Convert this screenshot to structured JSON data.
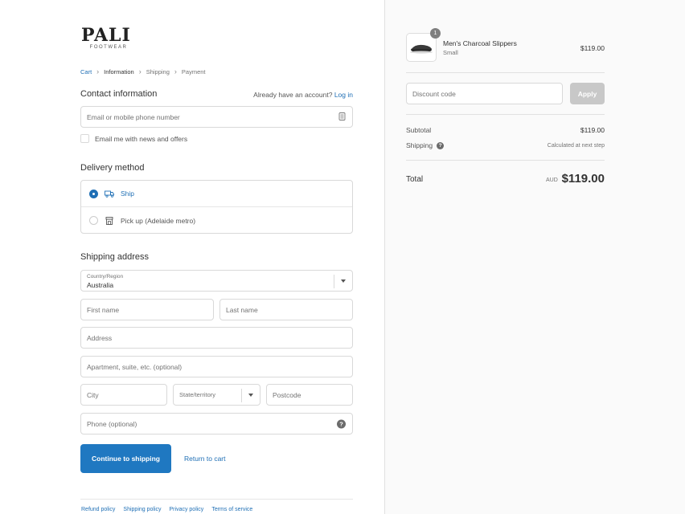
{
  "brand": {
    "name": "PALI",
    "tagline": "FOOTWEAR"
  },
  "breadcrumb": {
    "cart": "Cart",
    "information": "Information",
    "shipping": "Shipping",
    "payment": "Payment",
    "separator": "›"
  },
  "contact": {
    "title": "Contact information",
    "account_prompt": "Already have an account?",
    "login_link": "Log in",
    "email_placeholder": "Email or mobile phone number",
    "newsletter_label": "Email me with news and offers"
  },
  "delivery": {
    "title": "Delivery method",
    "options": [
      {
        "label": "Ship",
        "selected": true
      },
      {
        "label": "Pick up (Adelaide metro)",
        "selected": false
      }
    ]
  },
  "address": {
    "title": "Shipping address",
    "country_label": "Country/Region",
    "country_value": "Australia",
    "first_name": "First name",
    "last_name": "Last name",
    "address": "Address",
    "apartment": "Apartment, suite, etc. (optional)",
    "city": "City",
    "state": "State/territory",
    "postcode": "Postcode",
    "phone": "Phone (optional)",
    "help_glyph": "?"
  },
  "actions": {
    "continue": "Continue to shipping",
    "return": "Return to cart"
  },
  "footer": {
    "links": [
      "Refund policy",
      "Shipping policy",
      "Privacy policy",
      "Terms of service"
    ]
  },
  "order": {
    "item": {
      "name": "Men's Charcoal Slippers",
      "variant": "Small",
      "price": "$119.00",
      "quantity": "1"
    },
    "discount_placeholder": "Discount code",
    "apply": "Apply",
    "subtotal_label": "Subtotal",
    "subtotal_value": "$119.00",
    "shipping_label": "Shipping",
    "shipping_value": "Calculated at next step",
    "total_label": "Total",
    "currency": "AUD",
    "total_value": "$119.00"
  },
  "colors": {
    "accent": "#1f78c1",
    "link": "#1f6fb5",
    "panel": "#fafafa"
  }
}
